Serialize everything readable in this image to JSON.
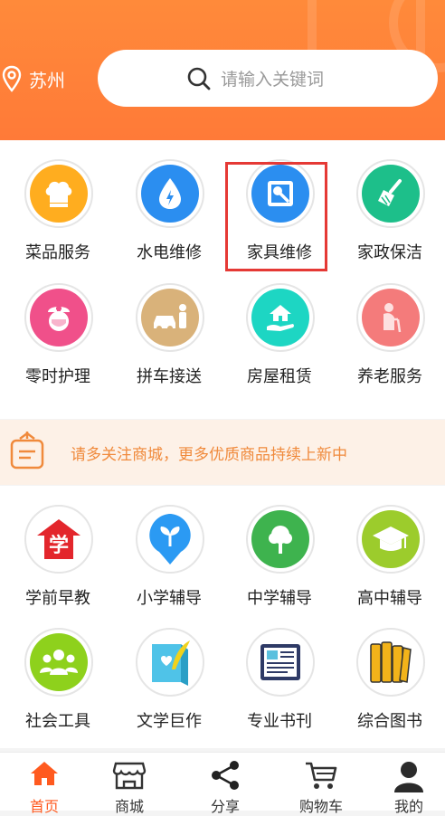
{
  "header": {
    "city": "苏州",
    "search_placeholder": "请输入关键词"
  },
  "services_top": [
    {
      "label": "菜品服务",
      "icon": "chef-hat-icon",
      "color": "#ffad1f"
    },
    {
      "label": "水电维修",
      "icon": "water-drop-icon",
      "color": "#2b8ef0"
    },
    {
      "label": "家具维修",
      "icon": "repair-tool-icon",
      "color": "#2b8ef0"
    },
    {
      "label": "家政保洁",
      "icon": "broom-icon",
      "color": "#1dbf8a"
    },
    {
      "label": "零时护理",
      "icon": "nurse-icon",
      "color": "#f0508a"
    },
    {
      "label": "拼车接送",
      "icon": "car-person-icon",
      "color": "#d9b27a"
    },
    {
      "label": "房屋租赁",
      "icon": "house-hand-icon",
      "color": "#1dd6c3"
    },
    {
      "label": "养老服务",
      "icon": "elderly-icon",
      "color": "#f47b7b"
    }
  ],
  "notice": {
    "text": "请多关注商城，更多优质商品持续上新中"
  },
  "services_bottom": [
    {
      "label": "学前早教",
      "icon": "xue-badge-icon",
      "color": "#e3262c"
    },
    {
      "label": "小学辅导",
      "icon": "sprout-icon",
      "color": "#2b9af3"
    },
    {
      "label": "中学辅导",
      "icon": "tree-icon",
      "color": "#3eb34e"
    },
    {
      "label": "高中辅导",
      "icon": "graduation-cap-icon",
      "color": "#9ccc2c"
    },
    {
      "label": "社会工具",
      "icon": "people-group-icon",
      "color": "#8ed11c"
    },
    {
      "label": "文学巨作",
      "icon": "book-feather-icon",
      "color": "#4fc3e8"
    },
    {
      "label": "专业书刊",
      "icon": "magazine-icon",
      "color": "#2e3a66"
    },
    {
      "label": "综合图书",
      "icon": "books-icon",
      "color": "#f2b31a"
    }
  ],
  "tabbar": {
    "items": [
      {
        "label": "首页",
        "icon": "home-icon",
        "active": true
      },
      {
        "label": "商城",
        "icon": "store-icon",
        "active": false
      },
      {
        "label": "分享",
        "icon": "share-icon",
        "active": false
      },
      {
        "label": "购物车",
        "icon": "cart-icon",
        "active": false
      },
      {
        "label": "我的",
        "icon": "user-icon",
        "active": false
      }
    ],
    "active_color": "#ff5a1f"
  }
}
